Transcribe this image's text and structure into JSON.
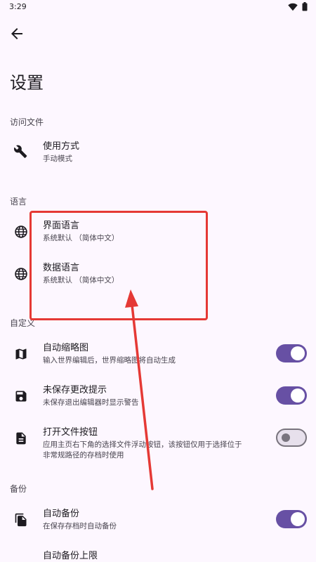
{
  "status_bar": {
    "time": "3:29"
  },
  "page": {
    "title": "设置"
  },
  "sections": {
    "files": {
      "header": "访问文件",
      "usage": {
        "title": "使用方式",
        "summary": "手动模式"
      }
    },
    "language": {
      "header": "语言",
      "ui_language": {
        "title": "界面语言",
        "summary": "系统默认 （简体中文）"
      },
      "data_language": {
        "title": "数据语言",
        "summary": "系统默认 （简体中文）"
      }
    },
    "custom": {
      "header": "自定义",
      "auto_thumbnail": {
        "title": "自动缩略图",
        "summary": "输入世界编辑后，世界缩略图将自动生成",
        "enabled": true
      },
      "unsaved_prompt": {
        "title": "未保存更改提示",
        "summary": "未保存退出编辑器时显示警告",
        "enabled": true
      },
      "open_file_button": {
        "title": "打开文件按钮",
        "summary_line1": "应用主页右下角的选择文件浮动按钮，该按钮仅用于选择位于",
        "summary_line2": "非常规路径的存档时使用",
        "enabled": false
      }
    },
    "backup": {
      "header": "备份",
      "auto_backup": {
        "title": "自动备份",
        "summary": "在保存存档时自动备份",
        "enabled": true
      },
      "backup_limit": {
        "title": "自动备份上限"
      }
    }
  },
  "icons": {
    "back": "arrow-left-icon",
    "usage": "tools-icon",
    "language": "globe-icon",
    "thumbnail": "map-icon",
    "save": "floppy-disk-icon",
    "file": "document-icon",
    "backup": "copy-file-icon"
  },
  "colors": {
    "background": "#fdf7ff",
    "accent": "#6750a4",
    "annotation": "#e53935"
  }
}
